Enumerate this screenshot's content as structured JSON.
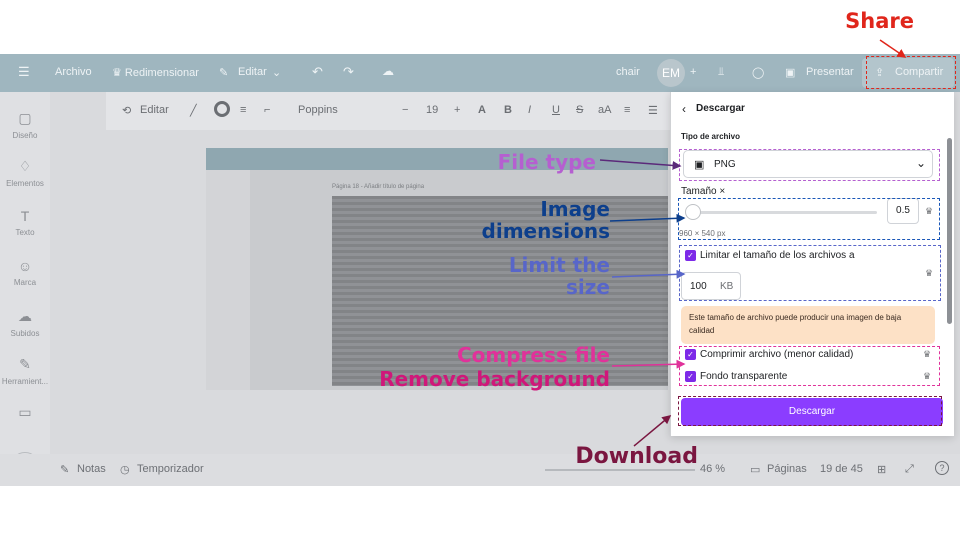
{
  "app": {
    "topbar": {
      "menu_icon": "hamburger-icon",
      "archivo": "Archivo",
      "redimensionar": "♛ Redimensionar",
      "editar": "Editar",
      "chair": "chair",
      "avatar": "EM",
      "presentar": "Presentar",
      "compartir": "Compartir"
    },
    "toolbar": {
      "editar": "Editar",
      "font": "Poppins",
      "font_size": "19"
    },
    "sidebar": [
      {
        "label": "Diseño",
        "icon": "▢"
      },
      {
        "label": "Elementos",
        "icon": "♢"
      },
      {
        "label": "Texto",
        "icon": "T"
      },
      {
        "label": "Marca",
        "icon": "☺"
      },
      {
        "label": "Subidos",
        "icon": "☁"
      },
      {
        "label": "Herramient...",
        "icon": "✎"
      }
    ],
    "canvas": {
      "page_label": "Página 18 - Añadir título de página"
    },
    "bottombar": {
      "notas": "Notas",
      "temporizador": "Temporizador",
      "zoom": "46 %",
      "paginas": "Páginas",
      "page_count": "19 de 45"
    }
  },
  "panel": {
    "back_title": "Descargar",
    "file_type_label": "Tipo de archivo",
    "file_type_value": "PNG",
    "size_label": "Tamaño ×",
    "size_value": "0.5",
    "size_slider_fraction": 0.03,
    "dimensions": "960 × 540 px",
    "limit_label": "Limitar el tamaño de los archivos a",
    "limit_value": "100",
    "limit_unit": "KB",
    "warning": "Este tamaño de archivo puede producir una imagen de baja calidad",
    "compress_label": "Comprimir archivo (menor calidad)",
    "transparent_label": "Fondo transparente",
    "download_button": "Descargar"
  },
  "annotations": {
    "share": "Share",
    "file_type": "File type",
    "image_dimensions": "Image dimensions",
    "limit_size": "Limit the size",
    "compress_file": "Compress file",
    "remove_background": "Remove background",
    "download": "Download"
  },
  "colors": {
    "share": "#e0261b",
    "file_type": "#7a3fa8",
    "image_dimensions": "#0d3f8c",
    "limit_size": "#5866c9",
    "compress": "#e0329a",
    "remove_bg": "#d0177a",
    "download": "#7a1640",
    "canva_purple": "#8b3dff"
  }
}
